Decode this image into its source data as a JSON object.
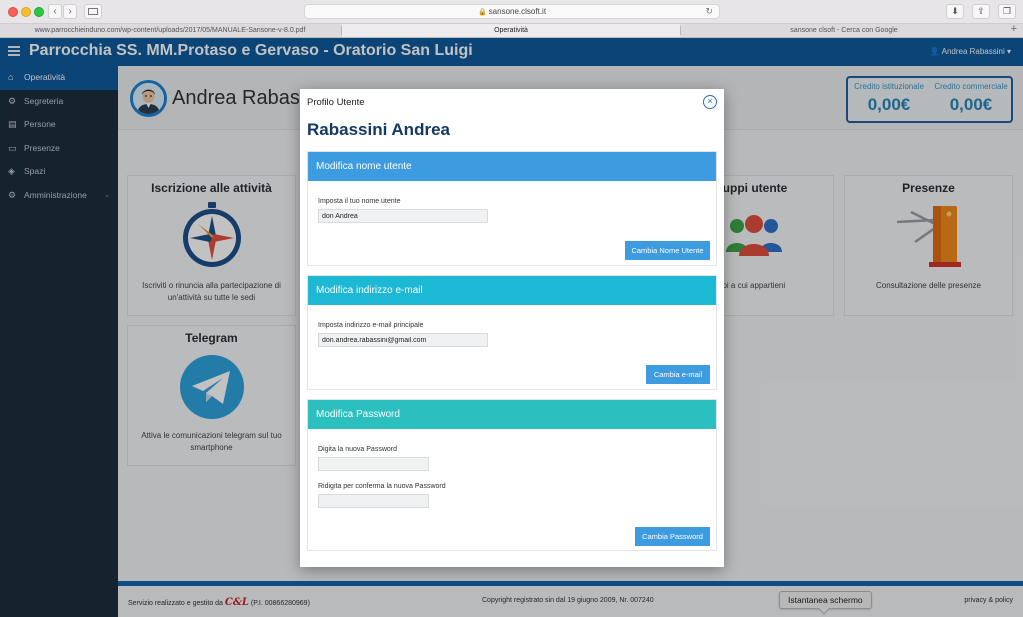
{
  "browser": {
    "url": "sansone.clsoft.it",
    "tabs": [
      {
        "label": "www.parrocchieinduno.com/wp-content/uploads/2017/05/MANUALE-Sansone-v-8.0.pdf"
      },
      {
        "label": "Operatività"
      },
      {
        "label": "sansone clsoft - Cerca con Google"
      }
    ],
    "new_tab_glyph": "+",
    "back_glyph": "‹",
    "forward_glyph": "›"
  },
  "header": {
    "title": "Parrocchia SS. MM.Protaso e Gervaso - Oratorio San Luigi",
    "user_menu": "Andrea Rabassini ▾"
  },
  "sidebar": {
    "items": [
      {
        "label": "Operatività",
        "icon": "home-icon",
        "glyph": "⌂"
      },
      {
        "label": "Segreteria",
        "icon": "gear-icon",
        "glyph": "⚙"
      },
      {
        "label": "Persone",
        "icon": "id-card-icon",
        "glyph": "▤"
      },
      {
        "label": "Presenze",
        "icon": "folder-icon",
        "glyph": "▭"
      },
      {
        "label": "Spazi",
        "icon": "layers-icon",
        "glyph": "◈"
      },
      {
        "label": "Amministrazione",
        "icon": "settings-icon",
        "glyph": "⚙"
      }
    ]
  },
  "profile": {
    "name": "Andrea Rabassi"
  },
  "credits": {
    "institutional_label": "Credito istituzionale",
    "institutional_value": "0,00€",
    "commercial_label": "Credito commerciale",
    "commercial_value": "0,00€"
  },
  "cards": {
    "iscrizione": {
      "title": "Iscrizione alle attività",
      "desc": "Iscriviti o rinuncia alla partecipazione di un'attività su tutte le sedi"
    },
    "gruppi": {
      "title": "ruppi utente",
      "desc": "ppi a cui appartieni"
    },
    "presenze": {
      "title": "Presenze",
      "desc": "Consultazione delle presenze"
    },
    "telegram": {
      "title": "Telegram",
      "desc": "Attiva le comunicazioni telegram sul tuo smartphone"
    }
  },
  "modal": {
    "header_title": "Profilo Utente",
    "close_glyph": "×",
    "user_name": "Rabassini Andrea",
    "username_panel": {
      "title": "Modifica nome utente",
      "field_label": "Imposta il tuo nome utente",
      "field_value": "don Andrea",
      "button": "Cambia Nome Utente",
      "color": "#3d9be0"
    },
    "email_panel": {
      "title": "Modifica indirizzo e-mail",
      "field_label": "Imposta indirizzo e-mail principale",
      "field_value": "don.andrea.rabassini@gmail.com",
      "button": "Cambia e-mail",
      "color": "#1db8d4"
    },
    "password_panel": {
      "title": "Modifica Password",
      "field1_label": "Digita la nuova Password",
      "field1_value": "",
      "field2_label": "Ridigita per conferma la nuova Password",
      "field2_value": "",
      "button": "Cambia Password",
      "color": "#2bbfbf"
    }
  },
  "footer": {
    "left_text": "Servizio realizzato e gestito da",
    "logo_text": "C&L",
    "left_suffix": "(P.I. 00866280969)",
    "center_text": "Copyright registrato sin dal 19 giugno 2009, Nr. 007240",
    "right_text": "privacy & policy",
    "tooltip": "Istantanea schermo"
  }
}
